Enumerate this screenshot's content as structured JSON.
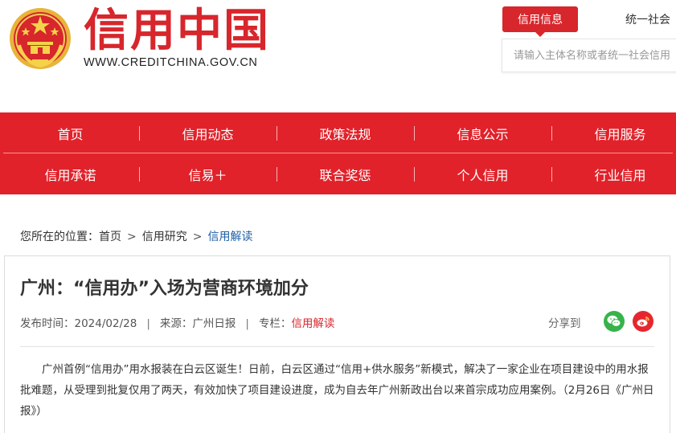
{
  "header": {
    "site_title": "信用中国",
    "site_url": "WWW.CREDITCHINA.GOV.CN",
    "emblem_icon": "national-emblem-icon"
  },
  "search": {
    "tab_active": "信用信息",
    "tab_other": "统一社会",
    "placeholder": "请输入主体名称或者统一社会信用"
  },
  "nav": {
    "row1": [
      "首页",
      "信用动态",
      "政策法规",
      "信息公示",
      "信用服务"
    ],
    "row2": [
      "信用承诺",
      "信易＋",
      "联合奖惩",
      "个人信用",
      "行业信用"
    ]
  },
  "breadcrumb": {
    "prefix": "您所在的位置：",
    "home": "首页",
    "section": "信用研究",
    "current": "信用解读",
    "sep": ">"
  },
  "article": {
    "title": "广州：“信用办”入场为营商环境加分",
    "publish_label": "发布时间：",
    "publish_date": "2024/02/28",
    "source_label": "来源：",
    "source": "广州日报",
    "column_label": "专栏：",
    "column": "信用解读",
    "share_label": "分享到",
    "body": "广州首例“信用办”用水报装在白云区诞生！日前，白云区通过“信用+供水服务”新模式，解决了一家企业在项目建设中的用水报批难题，从受理到批复仅用了两天，有效加快了项目建设进度，成为自去年广州新政出台以来首宗成功应用案例。（2月26日《广州日报》）"
  },
  "colors": {
    "brand_red": "#d7262c",
    "nav_red": "#e1222a",
    "link_blue": "#1f5fa8",
    "wechat_green": "#37b34a",
    "weibo_red": "#e6262e"
  }
}
